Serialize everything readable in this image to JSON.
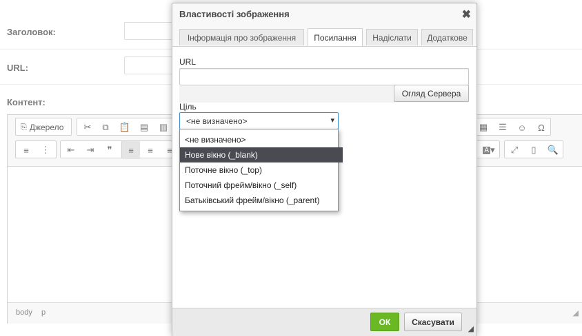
{
  "form": {
    "title_label": "Заголовок:",
    "url_label": "URL:",
    "content_label": "Контент:"
  },
  "editor": {
    "source_label": "Джерело",
    "status_path": [
      "body",
      "p"
    ]
  },
  "dialog": {
    "title": "Властивості зображення",
    "tabs": [
      {
        "label": "Інформація про зображення",
        "active": false
      },
      {
        "label": "Посилання",
        "active": true
      },
      {
        "label": "Надіслати",
        "active": false
      },
      {
        "label": "Додаткове",
        "active": false
      }
    ],
    "url_label": "URL",
    "url_value": "",
    "browse_server_label": "Огляд Сервера",
    "target_label": "Ціль",
    "target_selected": "<не визначено>",
    "target_options": [
      {
        "label": "<не визначено>",
        "highlighted": false
      },
      {
        "label": "Нове вікно (_blank)",
        "highlighted": true
      },
      {
        "label": "Поточне вікно (_top)",
        "highlighted": false
      },
      {
        "label": "Поточний фрейм/вікно (_self)",
        "highlighted": false
      },
      {
        "label": "Батьківський фрейм/вікно (_parent)",
        "highlighted": false
      }
    ],
    "ok_label": "ОК",
    "cancel_label": "Скасувати",
    "ok_color": "#6ab824",
    "highlight_color": "#4a4a52"
  }
}
